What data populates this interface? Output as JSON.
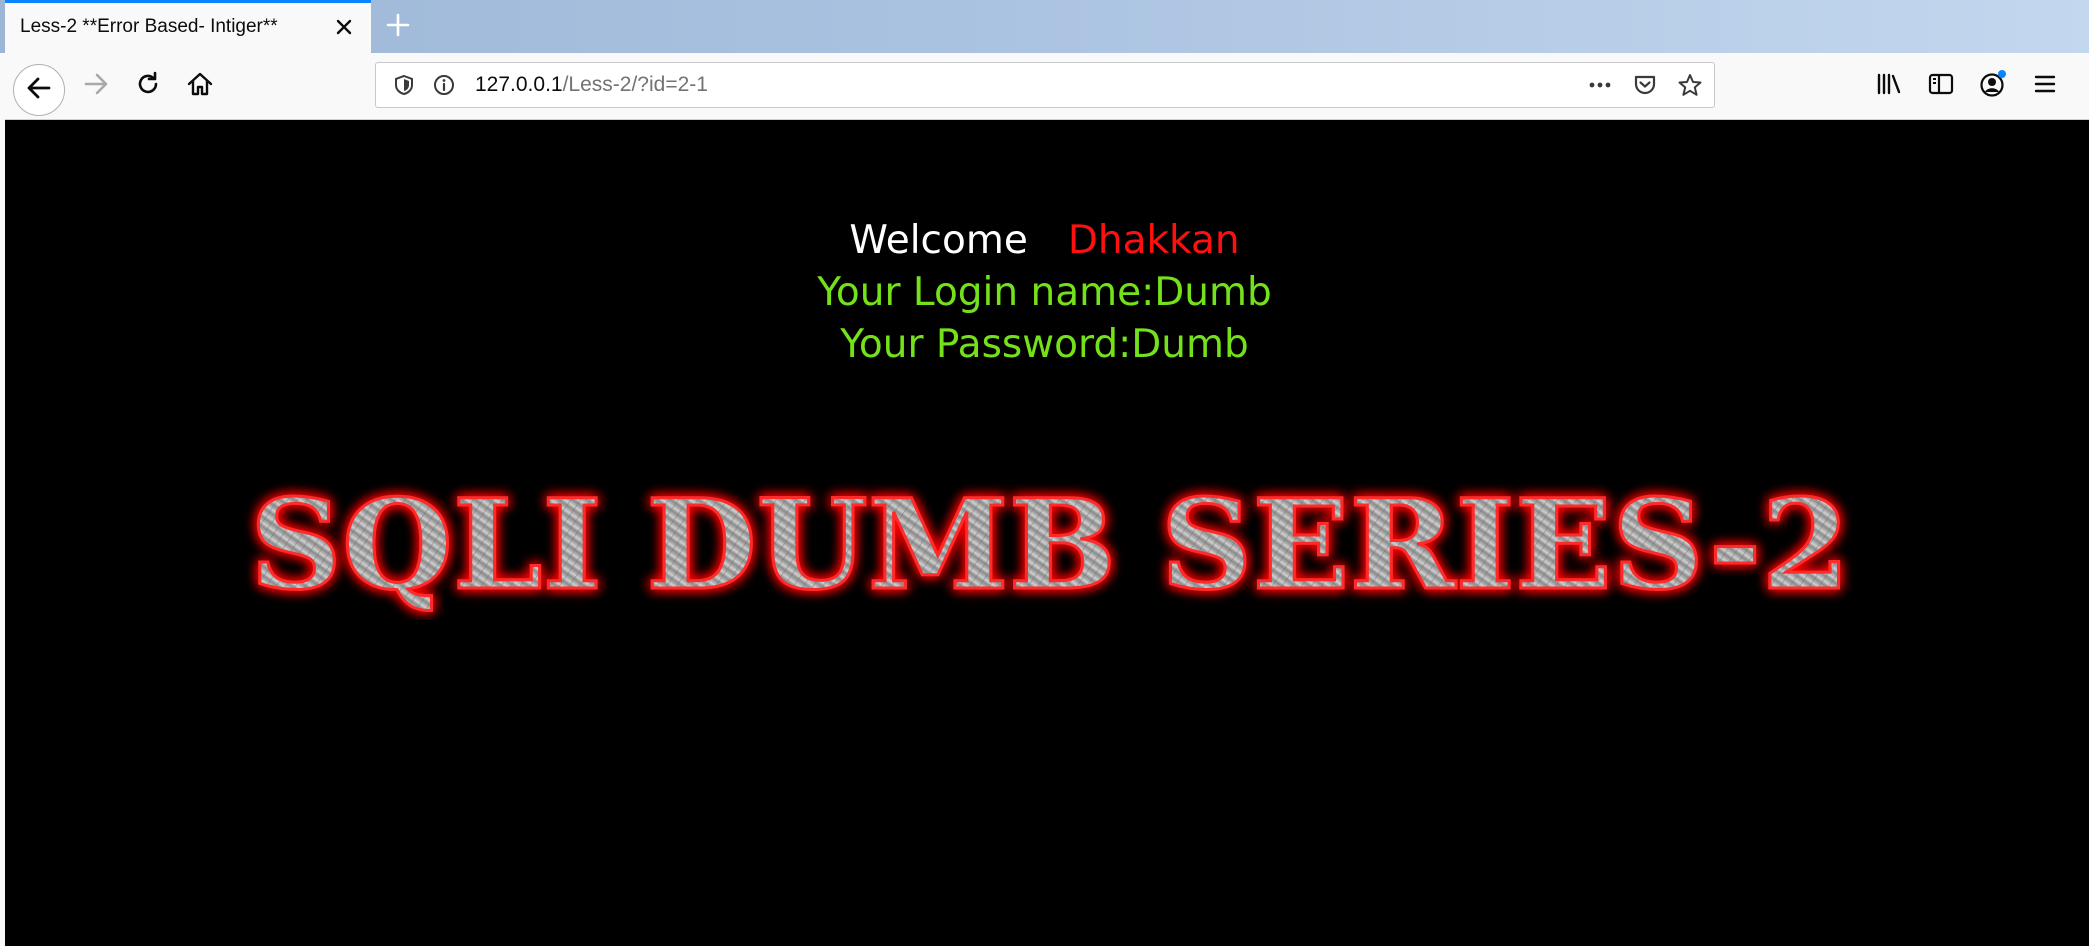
{
  "browser": {
    "tab_title": "Less-2 **Error Based- Intiger**",
    "url_host": "127.0.0.1",
    "url_path": "/Less-2/?id=2-1"
  },
  "page": {
    "welcome_label": "Welcome",
    "welcome_name": "Dhakkan",
    "login_line": "Your Login name:Dumb",
    "password_line": "Your Password:Dumb",
    "banner_text": "SQLI DUMB SERIES-2"
  },
  "colors": {
    "background": "#000000",
    "welcome_name": "#ff1010",
    "result_text": "#74e21a",
    "banner_glow": "#ff0000"
  },
  "icons": [
    "close-icon",
    "plus-icon",
    "back-arrow-icon",
    "forward-arrow-icon",
    "reload-icon",
    "home-icon",
    "shield-icon",
    "info-icon",
    "more-icon",
    "pocket-icon",
    "star-icon",
    "library-icon",
    "sidebar-icon",
    "account-icon",
    "menu-icon"
  ]
}
